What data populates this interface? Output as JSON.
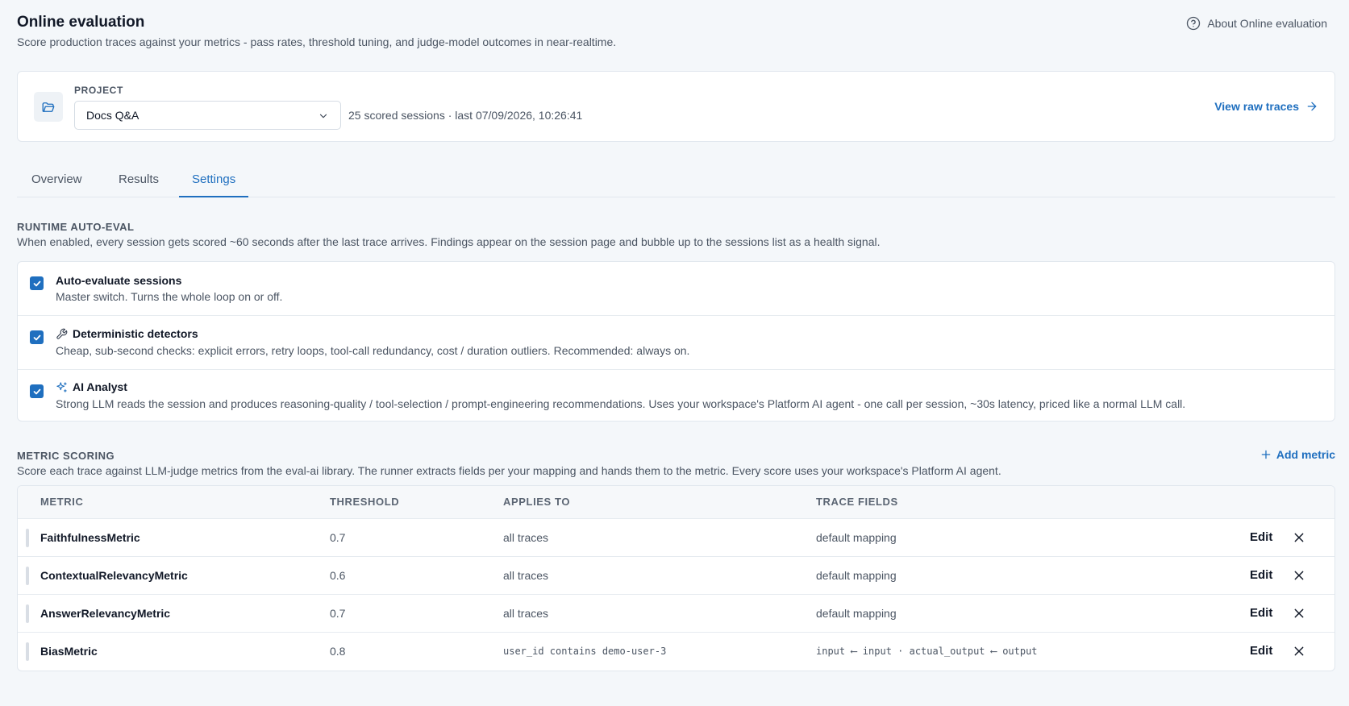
{
  "header": {
    "title": "Online evaluation",
    "subtitle": "Score production traces against your metrics - pass rates, threshold tuning, and judge-model outcomes in near-realtime.",
    "about_label": "About Online evaluation"
  },
  "project": {
    "label": "PROJECT",
    "selected": "Docs Q&A",
    "meta": "25 scored sessions · last 07/09/2026, 10:26:41",
    "raw_link": "View raw traces"
  },
  "tabs": [
    {
      "label": "Overview",
      "active": false
    },
    {
      "label": "Results",
      "active": false
    },
    {
      "label": "Settings",
      "active": true
    }
  ],
  "runtime": {
    "title": "RUNTIME AUTO-EVAL",
    "description": "When enabled, every session gets scored ~60 seconds after the last trace arrives. Findings appear on the session page and bubble up to the sessions list as a health signal.",
    "options": [
      {
        "title": "Auto-evaluate sessions",
        "description": "Master switch. Turns the whole loop on or off.",
        "checked": true,
        "icon": "none"
      },
      {
        "title": "Deterministic detectors",
        "description": "Cheap, sub-second checks: explicit errors, retry loops, tool-call redundancy, cost / duration outliers. Recommended: always on.",
        "checked": true,
        "icon": "wrench-icon"
      },
      {
        "title": "AI Analyst",
        "description": "Strong LLM reads the session and produces reasoning-quality / tool-selection / prompt-engineering recommendations. Uses your workspace's Platform AI agent - one call per session, ~30s latency, priced like a normal LLM call.",
        "checked": true,
        "icon": "sparkles-icon"
      }
    ]
  },
  "metrics": {
    "title": "METRIC SCORING",
    "description": "Score each trace against LLM-judge metrics from the eval-ai library. The runner extracts fields per your mapping and hands them to the metric. Every score uses your workspace's Platform AI agent.",
    "add_label": "Add metric",
    "columns": [
      "METRIC",
      "THRESHOLD",
      "APPLIES TO",
      "TRACE FIELDS"
    ],
    "edit_label": "Edit",
    "rows": [
      {
        "name": "FaithfulnessMetric",
        "threshold": "0.7",
        "applies_to": "all traces",
        "trace_fields": "default mapping",
        "mono": false
      },
      {
        "name": "ContextualRelevancyMetric",
        "threshold": "0.6",
        "applies_to": "all traces",
        "trace_fields": "default mapping",
        "mono": false
      },
      {
        "name": "AnswerRelevancyMetric",
        "threshold": "0.7",
        "applies_to": "all traces",
        "trace_fields": "default mapping",
        "mono": false
      },
      {
        "name": "BiasMetric",
        "threshold": "0.8",
        "applies_to": "user_id contains demo-user-3",
        "trace_fields": "input ⟵ input · actual_output ⟵ output",
        "mono": true
      }
    ]
  },
  "colors": {
    "accent": "#1f6fbf",
    "background": "#f4f7fa",
    "card": "#ffffff",
    "border": "#e1e7ee"
  }
}
